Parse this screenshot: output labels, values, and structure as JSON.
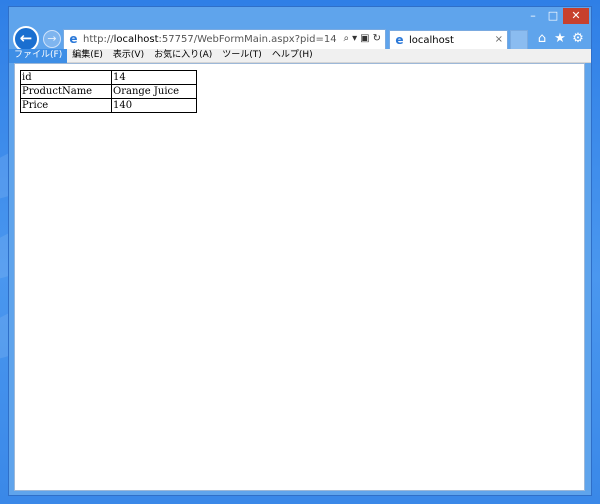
{
  "window": {
    "controls": {
      "minimize": "–",
      "maximize": "□",
      "close": "✕"
    }
  },
  "nav": {
    "back_icon": "back-arrow-icon",
    "forward_icon": "forward-arrow-icon",
    "address": {
      "protocol": "http://",
      "host": "localhost",
      "path": ":57757/WebFormMain.aspx?pid=14",
      "tools": [
        "⌕",
        "▾",
        "▣",
        "↻"
      ]
    },
    "tab": {
      "title": "localhost",
      "close": "×"
    },
    "right_icons": [
      "⌂",
      "★",
      "⚙"
    ]
  },
  "menu": {
    "items": [
      {
        "label": "ファイル(F)",
        "active": true
      },
      {
        "label": "編集(E)",
        "active": false
      },
      {
        "label": "表示(V)",
        "active": false
      },
      {
        "label": "お気に入り(A)",
        "active": false
      },
      {
        "label": "ツール(T)",
        "active": false
      },
      {
        "label": "ヘルプ(H)",
        "active": false
      }
    ]
  },
  "details": {
    "rows": [
      {
        "key": "id",
        "value": "14"
      },
      {
        "key": "ProductName",
        "value": "Orange Juice"
      },
      {
        "key": "Price",
        "value": "140"
      }
    ]
  },
  "colors": {
    "accent": "#3d8ee6",
    "back_button": "#1a6fd0",
    "close_button": "#c7402d"
  }
}
